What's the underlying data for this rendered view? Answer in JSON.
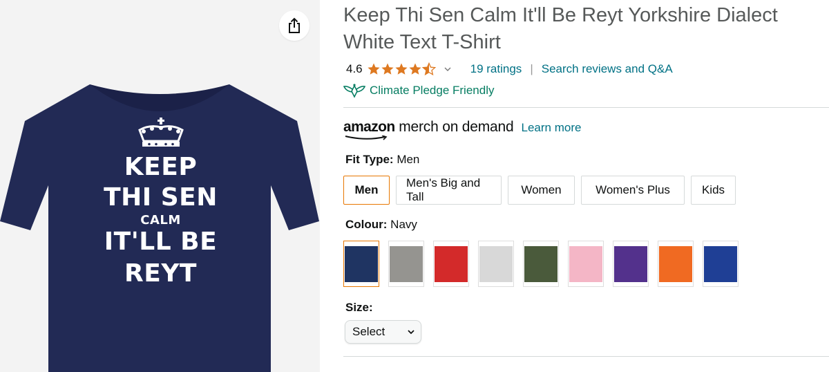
{
  "product_image": {
    "shirt_color": "#222a55",
    "print_lines": [
      "KEEP",
      "THI SEN",
      "CALM",
      "IT'LL BE",
      "REYT"
    ],
    "share_icon": "share-icon"
  },
  "product": {
    "title": "Keep Thi Sen Calm It'll Be Reyt Yorkshire Dialect White Text T-Shirt",
    "rating": "4.6",
    "stars_filled": 4.5,
    "ratings_link": "19 ratings",
    "separator": "|",
    "search_link": "Search reviews and Q&A",
    "climate_pledge": "Climate Pledge Friendly"
  },
  "merch": {
    "brand_amazon": "amazon",
    "brand_rest": "merch on demand",
    "learn_more": "Learn more"
  },
  "fit_type": {
    "label": "Fit Type:",
    "value": "Men",
    "options": [
      "Men",
      "Men's Big and Tall",
      "Women",
      "Women's Plus",
      "Kids"
    ],
    "selected_index": 0
  },
  "colour": {
    "label": "Colour:",
    "value": "Navy",
    "swatches": [
      "#1f3462",
      "#959490",
      "#d32a2a",
      "#d8d8d8",
      "#4a5a3b",
      "#f4b6c6",
      "#53318c",
      "#f06a22",
      "#1f3f95"
    ],
    "selected_index": 0
  },
  "size": {
    "label": "Size:",
    "select_value": "Select"
  },
  "colors": {
    "link": "#007185",
    "pledge_green": "#067d62",
    "selected_border": "#e77600",
    "star": "#de7921"
  }
}
